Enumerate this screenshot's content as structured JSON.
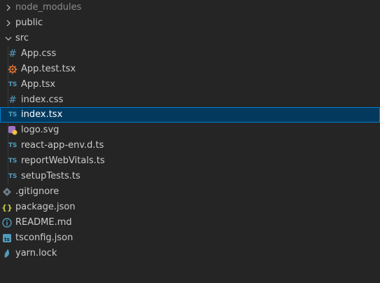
{
  "explorer": {
    "items": [
      {
        "label": "node_modules",
        "type": "folder",
        "state": "collapsed",
        "muted": true
      },
      {
        "label": "public",
        "type": "folder",
        "state": "collapsed"
      },
      {
        "label": "src",
        "type": "folder",
        "state": "expanded"
      },
      {
        "label": "App.css",
        "type": "file",
        "icon": "css-hash-icon",
        "glyph": "#"
      },
      {
        "label": "App.test.tsx",
        "type": "file",
        "icon": "test-gear-icon"
      },
      {
        "label": "App.tsx",
        "type": "file",
        "icon": "typescript-icon",
        "glyph": "TS"
      },
      {
        "label": "index.css",
        "type": "file",
        "icon": "css-hash-icon",
        "glyph": "#"
      },
      {
        "label": "index.tsx",
        "type": "file",
        "icon": "typescript-icon",
        "glyph": "TS",
        "selected": true
      },
      {
        "label": "logo.svg",
        "type": "file",
        "icon": "svg-image-icon"
      },
      {
        "label": "react-app-env.d.ts",
        "type": "file",
        "icon": "typescript-icon",
        "glyph": "TS"
      },
      {
        "label": "reportWebVitals.ts",
        "type": "file",
        "icon": "typescript-icon",
        "glyph": "TS"
      },
      {
        "label": "setupTests.ts",
        "type": "file",
        "icon": "typescript-icon",
        "glyph": "TS"
      },
      {
        "label": ".gitignore",
        "type": "file",
        "icon": "git-diamond-icon"
      },
      {
        "label": "package.json",
        "type": "file",
        "icon": "json-braces-icon",
        "glyph": "{}"
      },
      {
        "label": "README.md",
        "type": "file",
        "icon": "info-circle-icon",
        "glyph": "i"
      },
      {
        "label": "tsconfig.json",
        "type": "file",
        "icon": "tsconfig-icon",
        "glyph": "ts"
      },
      {
        "label": "yarn.lock",
        "type": "file",
        "icon": "yarn-icon"
      }
    ]
  },
  "colors": {
    "background": "#252526",
    "selected_bg": "#04395e",
    "selected_border": "#007fd4",
    "ts_blue": "#519aba",
    "json_yellow": "#cbcb41",
    "test_orange": "#e37933",
    "svg_purple": "#a074c4",
    "git_gray": "#6d8086"
  }
}
